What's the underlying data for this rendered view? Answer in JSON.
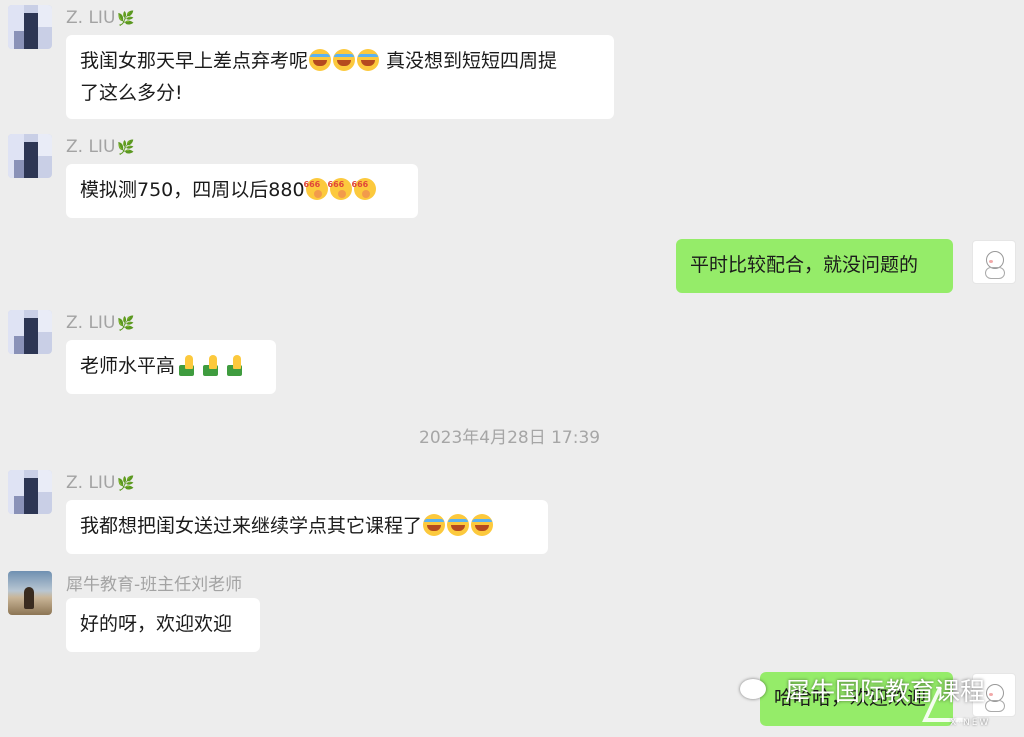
{
  "messages": [
    {
      "sender": "Z. LIU",
      "text": "我闺女那天早上差点弃考呢",
      "text2": " 真没想到短短四周提",
      "line2": "了这么多分!"
    },
    {
      "sender": "Z. LIU",
      "text": "模拟测750，四周以后880"
    },
    {
      "text": "平时比较配合，就没问题的"
    },
    {
      "sender": "Z. LIU",
      "text": "老师水平高"
    },
    {
      "sender": "Z. LIU",
      "text": "我都想把闺女送过来继续学点其它课程了"
    },
    {
      "sender": "犀牛教育-班主任刘老师",
      "text": "好的呀，欢迎欢迎"
    },
    {
      "text": "哈哈哈，欢迎欢迎"
    }
  ],
  "timestamp": "2023年4月28日 17:39",
  "watermark": {
    "text": "犀牛国际教育课程",
    "brand": "X·NEW"
  },
  "icons": {
    "leaf": "leaf-icon",
    "laugh": "tears-of-joy-emoji",
    "praise": "666-emoji",
    "thumb": "thumbs-up-emoji"
  },
  "colors": {
    "background": "#ededed",
    "incoming_bubble": "#ffffff",
    "outgoing_bubble": "#95ec69",
    "meta_text": "#a3a3a3"
  }
}
